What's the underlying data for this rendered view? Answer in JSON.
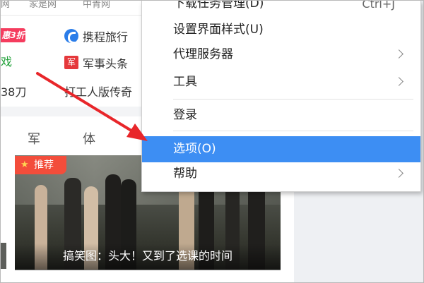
{
  "page": {
    "top_links": [
      "网",
      "家是网",
      "中青网"
    ],
    "promo_badge": "惠3折",
    "links": [
      {
        "name": "携程旅行",
        "icon": "ctrip-icon"
      },
      {
        "name": "军事头条",
        "icon": "military-icon",
        "icon_text": "军"
      }
    ],
    "green_text": "戏",
    "text_row3_left": "38刀",
    "text_row3_right": "打工人版传奇",
    "tabs": [
      "军",
      "体"
    ],
    "feature": {
      "badge": "推荐",
      "caption": "搞笑图：头大！又到了选课的时间"
    }
  },
  "menu": {
    "items": [
      {
        "label": "下载任务管理(D)",
        "shortcut": "Ctrl+J",
        "submenu": false,
        "selected": false
      },
      {
        "label": "设置界面样式(U)",
        "shortcut": "",
        "submenu": false,
        "selected": false
      },
      {
        "label": "代理服务器",
        "shortcut": "",
        "submenu": true,
        "selected": false
      },
      {
        "label": "工具",
        "shortcut": "",
        "submenu": true,
        "selected": false
      },
      {
        "label": "登录",
        "shortcut": "",
        "submenu": false,
        "selected": false
      },
      {
        "label": "选项(O)",
        "shortcut": "",
        "submenu": false,
        "selected": true
      },
      {
        "label": "帮助",
        "shortcut": "",
        "submenu": true,
        "selected": false
      }
    ]
  },
  "colors": {
    "menu_highlight": "#3d8ef3",
    "arrow": "#e8262a",
    "promo": "#f53c5e",
    "badge": "#f34d3b",
    "green_text": "#22a13a"
  }
}
